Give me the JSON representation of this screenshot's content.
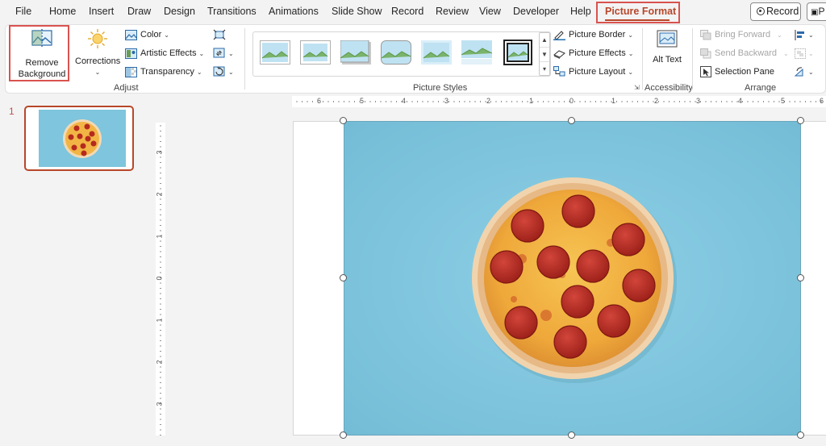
{
  "menu": {
    "tabs": [
      "File",
      "Home",
      "Insert",
      "Draw",
      "Design",
      "Transitions",
      "Animations",
      "Slide Show",
      "Record",
      "Review",
      "View",
      "Developer",
      "Help",
      "Picture Format"
    ],
    "record_label": "Record",
    "present_label": "P"
  },
  "ribbon": {
    "adjust": {
      "remove_background": "Remove Background",
      "corrections": "Corrections",
      "color": "Color",
      "artistic_effects": "Artistic Effects",
      "transparency": "Transparency",
      "label": "Adjust"
    },
    "picture_styles": {
      "label": "Picture Styles",
      "picture_border": "Picture Border",
      "picture_effects": "Picture Effects",
      "picture_layout": "Picture Layout"
    },
    "accessibility": {
      "alt_text": "Alt Text",
      "label": "Accessibility"
    },
    "arrange": {
      "bring_forward": "Bring Forward",
      "send_backward": "Send Backward",
      "selection_pane": "Selection Pane",
      "label": "Arrange"
    }
  },
  "slides": {
    "current_number": "1"
  },
  "rulers": {
    "horizontal": [
      "6",
      "5",
      "4",
      "3",
      "2",
      "1",
      "0",
      "1",
      "2",
      "3",
      "4",
      "5",
      "6"
    ],
    "vertical": [
      "3",
      "2",
      "1",
      "0",
      "1",
      "2",
      "3"
    ]
  },
  "colors": {
    "accent": "#b7472a",
    "highlight_box": "#d9534f",
    "picture_background": "#7ec4dc"
  }
}
